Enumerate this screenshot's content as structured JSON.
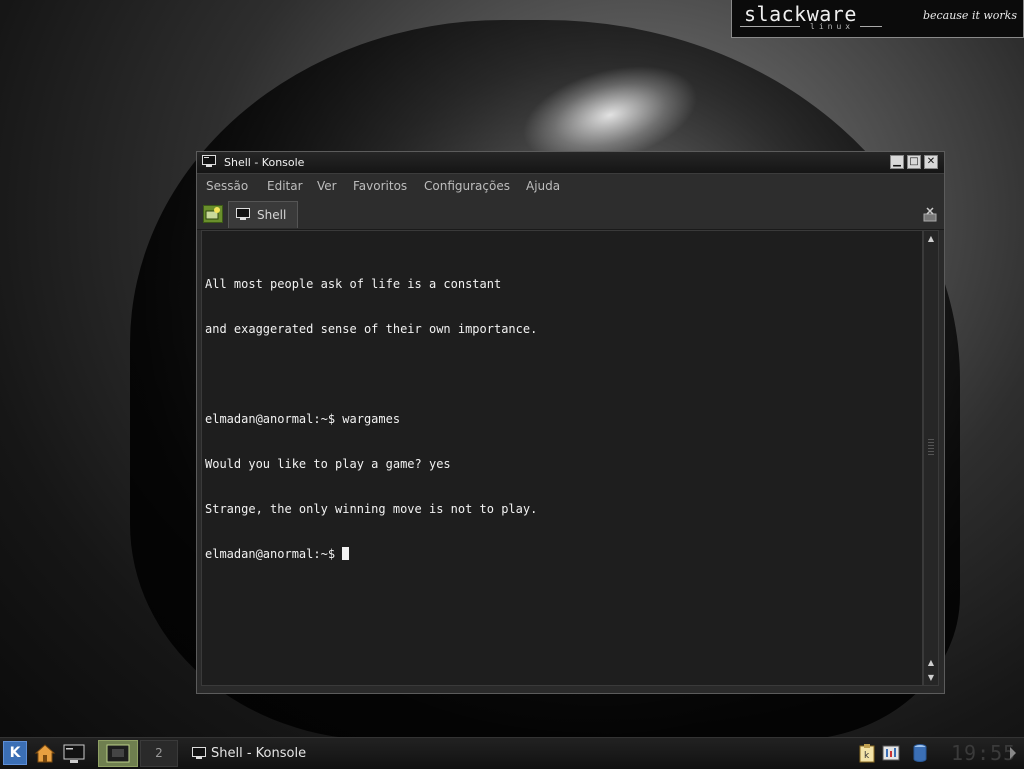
{
  "logo": {
    "wordmark": "slackware",
    "subtitle": "linux",
    "tagline": "because it works"
  },
  "window": {
    "title": "Shell - Konsole",
    "controls": {
      "minimize": "▁",
      "maximize": "□",
      "close": "✕"
    }
  },
  "menubar": {
    "items": [
      "Sessão",
      "Editar",
      "Ver",
      "Favoritos",
      "Configurações",
      "Ajuda"
    ]
  },
  "tabs": [
    {
      "label": "Shell"
    }
  ],
  "terminal": {
    "lines": [
      "All most people ask of life is a constant",
      "and exaggerated sense of their own importance.",
      "",
      "elmadan@anormal:~$ wargames",
      "Would you like to play a game? yes",
      "Strange, the only winning move is not to play."
    ],
    "prompt": "elmadan@anormal:~$ "
  },
  "scrollbar": {
    "up": "▲",
    "down": "▼"
  },
  "taskbar": {
    "kmenu_label": "K",
    "desktops": [
      "1",
      "2"
    ],
    "active_desktop": "1",
    "task_label": "Shell - Konsole",
    "clock": "19:55"
  },
  "colors": {
    "accent_green": "#6a8f2c",
    "kde_blue": "#3b6fb5"
  }
}
